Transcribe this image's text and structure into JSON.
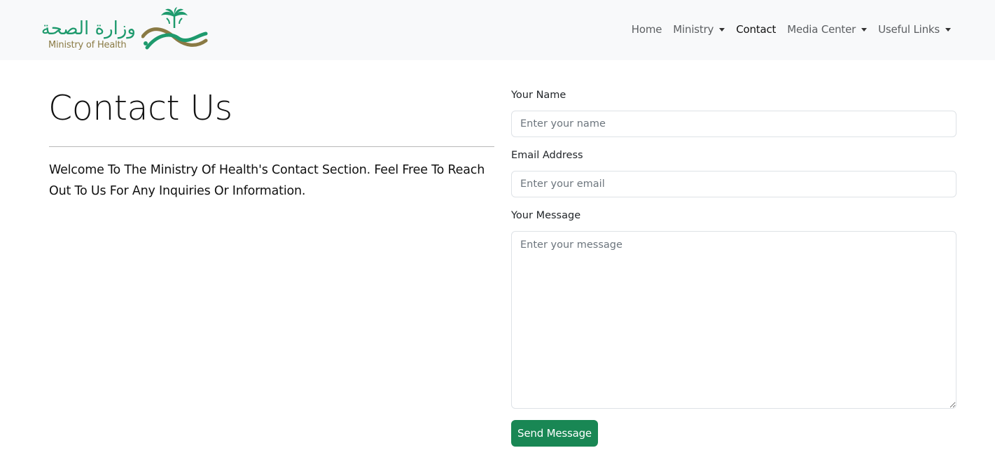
{
  "brand": {
    "arabic_name": "وزارة الصحة",
    "english_name": "Ministry of Health",
    "colors": {
      "green": "#1e9a6d",
      "gold": "#8a7a44"
    }
  },
  "nav": {
    "items": [
      {
        "label": "Home",
        "dropdown": false,
        "active": false
      },
      {
        "label": "Ministry",
        "dropdown": true,
        "active": false
      },
      {
        "label": "Contact",
        "dropdown": false,
        "active": true
      },
      {
        "label": "Media Center",
        "dropdown": true,
        "active": false
      },
      {
        "label": "Useful Links",
        "dropdown": true,
        "active": false
      }
    ]
  },
  "main": {
    "title": "Contact Us",
    "intro": "Welcome To The Ministry Of Health's Contact Section. Feel Free To Reach Out To Us For Any Inquiries Or Information."
  },
  "form": {
    "name_label": "Your Name",
    "name_placeholder": "Enter your name",
    "name_value": "",
    "email_label": "Email Address",
    "email_placeholder": "Enter your email",
    "email_value": "",
    "message_label": "Your Message",
    "message_placeholder": "Enter your message",
    "message_value": "",
    "submit_label": "Send Message",
    "submit_color": "#198754"
  }
}
